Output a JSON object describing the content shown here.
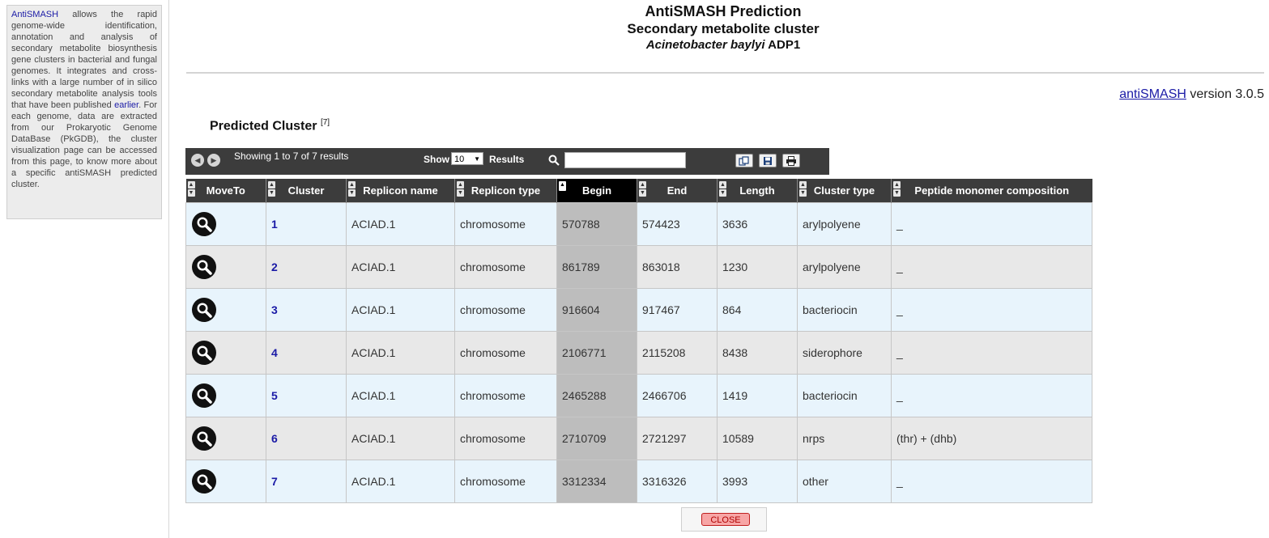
{
  "sidebar": {
    "link_antismash": "AntiSMASH",
    "text_1": " allows the rapid genome-wide identification, annotation and analysis of secondary metabolite biosynthesis gene clusters in bacterial and fungal genomes. It integrates and cross-links with a large number of in silico secondary metabolite analysis tools that have been published ",
    "link_earlier": "earlier",
    "text_2": ". For each genome, data are extracted from our Prokaryotic Genome DataBase (PkGDB), the cluster visualization page can be accessed from this page, to know more about a specific antiSMASH predicted cluster."
  },
  "header": {
    "title": "AntiSMASH Prediction",
    "subtitle": "Secondary metabolite cluster",
    "organism_italic": "Acinetobacter baylyi",
    "organism_strain": " ADP1"
  },
  "version": {
    "link": "antiSMASH",
    "text": " version 3.0.5"
  },
  "section": {
    "title": "Predicted Cluster",
    "footnote": "[7]"
  },
  "toolbar": {
    "showing": "Showing 1 to 7 of 7 results",
    "show_label": "Show",
    "page_size": "10",
    "results_label": "Results",
    "search_value": ""
  },
  "table": {
    "columns": [
      "MoveTo",
      "Cluster",
      "Replicon name",
      "Replicon type",
      "Begin",
      "End",
      "Length",
      "Cluster type",
      "Peptide monomer composition"
    ],
    "rows": [
      {
        "cluster": "1",
        "replicon_name": "ACIAD.1",
        "replicon_type": "chromosome",
        "begin": "570788",
        "end": "574423",
        "length": "3636",
        "cluster_type": "arylpolyene",
        "peptide": "_"
      },
      {
        "cluster": "2",
        "replicon_name": "ACIAD.1",
        "replicon_type": "chromosome",
        "begin": "861789",
        "end": "863018",
        "length": "1230",
        "cluster_type": "arylpolyene",
        "peptide": "_"
      },
      {
        "cluster": "3",
        "replicon_name": "ACIAD.1",
        "replicon_type": "chromosome",
        "begin": "916604",
        "end": "917467",
        "length": "864",
        "cluster_type": "bacteriocin",
        "peptide": "_"
      },
      {
        "cluster": "4",
        "replicon_name": "ACIAD.1",
        "replicon_type": "chromosome",
        "begin": "2106771",
        "end": "2115208",
        "length": "8438",
        "cluster_type": "siderophore",
        "peptide": "_"
      },
      {
        "cluster": "5",
        "replicon_name": "ACIAD.1",
        "replicon_type": "chromosome",
        "begin": "2465288",
        "end": "2466706",
        "length": "1419",
        "cluster_type": "bacteriocin",
        "peptide": "_"
      },
      {
        "cluster": "6",
        "replicon_name": "ACIAD.1",
        "replicon_type": "chromosome",
        "begin": "2710709",
        "end": "2721297",
        "length": "10589",
        "cluster_type": "nrps",
        "peptide": "(thr) + (dhb)"
      },
      {
        "cluster": "7",
        "replicon_name": "ACIAD.1",
        "replicon_type": "chromosome",
        "begin": "3312334",
        "end": "3316326",
        "length": "3993",
        "cluster_type": "other",
        "peptide": "_"
      }
    ]
  },
  "close_label": "CLOSE",
  "icons": {
    "moveto": "magnifier-icon",
    "prev": "arrow-left-icon",
    "next": "arrow-right-icon",
    "search": "search-icon",
    "copy": "copy-icon",
    "save": "save-icon",
    "print": "print-icon"
  },
  "colors": {
    "header_bg": "#3c3c3c",
    "sorted_col_bg": "#bdbdbd",
    "row_odd": "#e8f4fc",
    "row_even": "#e8e8e8",
    "link": "#1a1aa6",
    "close_bg": "#f7a6a6"
  }
}
